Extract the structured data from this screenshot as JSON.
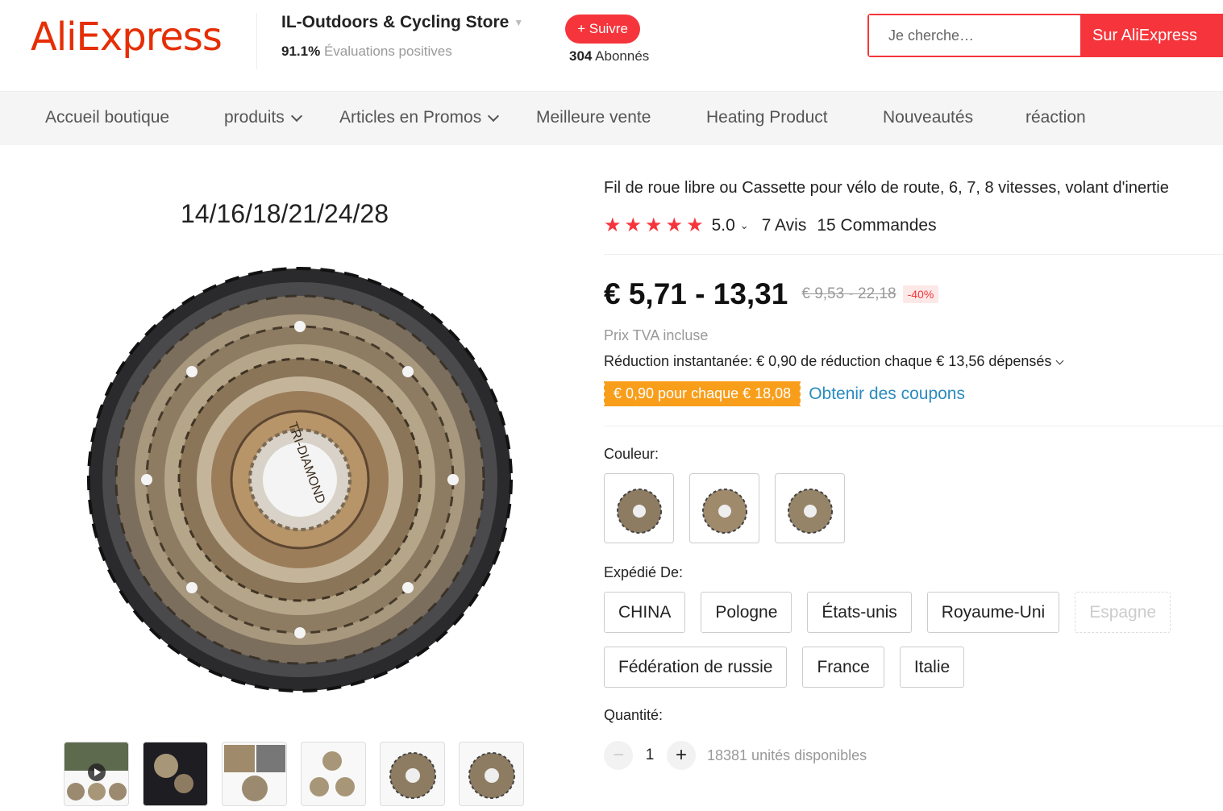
{
  "header": {
    "logo": "AliExpress",
    "store_name": "IL-Outdoors & Cycling Store",
    "store_rating_value": "91.1%",
    "store_rating_text": "Évaluations positives",
    "follow_label": "+ Suivre",
    "followers_count": "304",
    "followers_text": "Abonnés",
    "search_placeholder": "Je cherche…",
    "search_button": "Sur AliExpress",
    "brand_color": "#e62e04",
    "accent_color": "#f5353b"
  },
  "nav": {
    "items": [
      {
        "label": "Accueil boutique"
      },
      {
        "label": "produits"
      },
      {
        "label": "Articles en Promos"
      },
      {
        "label": "Meilleure vente"
      },
      {
        "label": "Heating Product"
      },
      {
        "label": "Nouveautés"
      },
      {
        "label": "réaction"
      }
    ]
  },
  "gallery": {
    "main_caption": "14/16/18/21/24/28",
    "hub_text": "TRI-DIAMOND",
    "thumbnail_icons": [
      "video-thumbnail",
      "dark-product-thumbnail",
      "detail-collage-thumbnail",
      "three-cassettes-thumbnail",
      "cassette-thumbnail",
      "cassette-thumbnail"
    ]
  },
  "product": {
    "title": "Fil de roue libre ou Cassette pour vélo de route, 6, 7, 8 vitesses, volant d'inertie",
    "rating": "5.0",
    "stars": 5,
    "reviews": "7 Avis",
    "orders": "15 Commandes",
    "price": "€ 5,71 - 13,31",
    "old_price": "€ 9,53 - 22,18",
    "discount": "-40%",
    "vat": "Prix TVA incluse",
    "reduction": "Réduction instantanée: € 0,90 de réduction chaque € 13,56 dépensés",
    "coupon": "€ 0,90 pour chaque € 18,08",
    "coupon_link": "Obtenir des coupons",
    "color_label": "Couleur:",
    "ship_label": "Expédié De:",
    "ship_options": [
      {
        "label": "CHINA",
        "available": true
      },
      {
        "label": "Pologne",
        "available": true
      },
      {
        "label": "États-unis",
        "available": true
      },
      {
        "label": "Royaume-Uni",
        "available": true
      },
      {
        "label": "Espagne",
        "available": false
      },
      {
        "label": "Fédération de russie",
        "available": true
      },
      {
        "label": "France",
        "available": true
      },
      {
        "label": "Italie",
        "available": true
      }
    ],
    "quantity_label": "Quantité:",
    "quantity_value": "1",
    "minus": "−",
    "plus": "+",
    "stock": "18381 unités disponibles"
  }
}
